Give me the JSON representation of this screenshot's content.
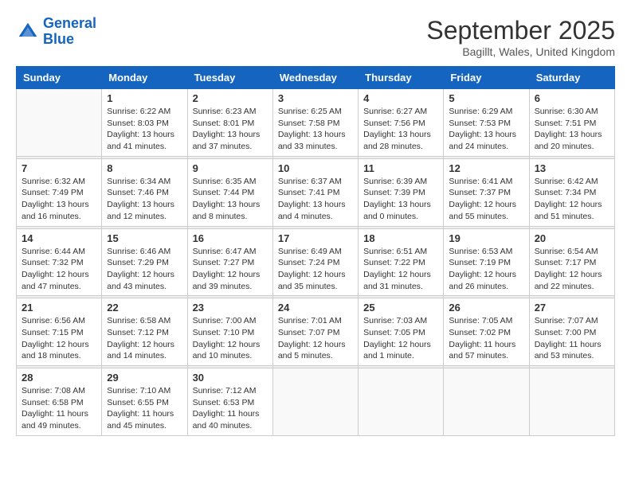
{
  "header": {
    "logo_line1": "General",
    "logo_line2": "Blue",
    "title": "September 2025",
    "subtitle": "Bagillt, Wales, United Kingdom"
  },
  "days_of_week": [
    "Sunday",
    "Monday",
    "Tuesday",
    "Wednesday",
    "Thursday",
    "Friday",
    "Saturday"
  ],
  "weeks": [
    [
      {
        "day": "",
        "info": ""
      },
      {
        "day": "1",
        "info": "Sunrise: 6:22 AM\nSunset: 8:03 PM\nDaylight: 13 hours\nand 41 minutes."
      },
      {
        "day": "2",
        "info": "Sunrise: 6:23 AM\nSunset: 8:01 PM\nDaylight: 13 hours\nand 37 minutes."
      },
      {
        "day": "3",
        "info": "Sunrise: 6:25 AM\nSunset: 7:58 PM\nDaylight: 13 hours\nand 33 minutes."
      },
      {
        "day": "4",
        "info": "Sunrise: 6:27 AM\nSunset: 7:56 PM\nDaylight: 13 hours\nand 28 minutes."
      },
      {
        "day": "5",
        "info": "Sunrise: 6:29 AM\nSunset: 7:53 PM\nDaylight: 13 hours\nand 24 minutes."
      },
      {
        "day": "6",
        "info": "Sunrise: 6:30 AM\nSunset: 7:51 PM\nDaylight: 13 hours\nand 20 minutes."
      }
    ],
    [
      {
        "day": "7",
        "info": "Sunrise: 6:32 AM\nSunset: 7:49 PM\nDaylight: 13 hours\nand 16 minutes."
      },
      {
        "day": "8",
        "info": "Sunrise: 6:34 AM\nSunset: 7:46 PM\nDaylight: 13 hours\nand 12 minutes."
      },
      {
        "day": "9",
        "info": "Sunrise: 6:35 AM\nSunset: 7:44 PM\nDaylight: 13 hours\nand 8 minutes."
      },
      {
        "day": "10",
        "info": "Sunrise: 6:37 AM\nSunset: 7:41 PM\nDaylight: 13 hours\nand 4 minutes."
      },
      {
        "day": "11",
        "info": "Sunrise: 6:39 AM\nSunset: 7:39 PM\nDaylight: 13 hours\nand 0 minutes."
      },
      {
        "day": "12",
        "info": "Sunrise: 6:41 AM\nSunset: 7:37 PM\nDaylight: 12 hours\nand 55 minutes."
      },
      {
        "day": "13",
        "info": "Sunrise: 6:42 AM\nSunset: 7:34 PM\nDaylight: 12 hours\nand 51 minutes."
      }
    ],
    [
      {
        "day": "14",
        "info": "Sunrise: 6:44 AM\nSunset: 7:32 PM\nDaylight: 12 hours\nand 47 minutes."
      },
      {
        "day": "15",
        "info": "Sunrise: 6:46 AM\nSunset: 7:29 PM\nDaylight: 12 hours\nand 43 minutes."
      },
      {
        "day": "16",
        "info": "Sunrise: 6:47 AM\nSunset: 7:27 PM\nDaylight: 12 hours\nand 39 minutes."
      },
      {
        "day": "17",
        "info": "Sunrise: 6:49 AM\nSunset: 7:24 PM\nDaylight: 12 hours\nand 35 minutes."
      },
      {
        "day": "18",
        "info": "Sunrise: 6:51 AM\nSunset: 7:22 PM\nDaylight: 12 hours\nand 31 minutes."
      },
      {
        "day": "19",
        "info": "Sunrise: 6:53 AM\nSunset: 7:19 PM\nDaylight: 12 hours\nand 26 minutes."
      },
      {
        "day": "20",
        "info": "Sunrise: 6:54 AM\nSunset: 7:17 PM\nDaylight: 12 hours\nand 22 minutes."
      }
    ],
    [
      {
        "day": "21",
        "info": "Sunrise: 6:56 AM\nSunset: 7:15 PM\nDaylight: 12 hours\nand 18 minutes."
      },
      {
        "day": "22",
        "info": "Sunrise: 6:58 AM\nSunset: 7:12 PM\nDaylight: 12 hours\nand 14 minutes."
      },
      {
        "day": "23",
        "info": "Sunrise: 7:00 AM\nSunset: 7:10 PM\nDaylight: 12 hours\nand 10 minutes."
      },
      {
        "day": "24",
        "info": "Sunrise: 7:01 AM\nSunset: 7:07 PM\nDaylight: 12 hours\nand 5 minutes."
      },
      {
        "day": "25",
        "info": "Sunrise: 7:03 AM\nSunset: 7:05 PM\nDaylight: 12 hours\nand 1 minute."
      },
      {
        "day": "26",
        "info": "Sunrise: 7:05 AM\nSunset: 7:02 PM\nDaylight: 11 hours\nand 57 minutes."
      },
      {
        "day": "27",
        "info": "Sunrise: 7:07 AM\nSunset: 7:00 PM\nDaylight: 11 hours\nand 53 minutes."
      }
    ],
    [
      {
        "day": "28",
        "info": "Sunrise: 7:08 AM\nSunset: 6:58 PM\nDaylight: 11 hours\nand 49 minutes."
      },
      {
        "day": "29",
        "info": "Sunrise: 7:10 AM\nSunset: 6:55 PM\nDaylight: 11 hours\nand 45 minutes."
      },
      {
        "day": "30",
        "info": "Sunrise: 7:12 AM\nSunset: 6:53 PM\nDaylight: 11 hours\nand 40 minutes."
      },
      {
        "day": "",
        "info": ""
      },
      {
        "day": "",
        "info": ""
      },
      {
        "day": "",
        "info": ""
      },
      {
        "day": "",
        "info": ""
      }
    ]
  ]
}
